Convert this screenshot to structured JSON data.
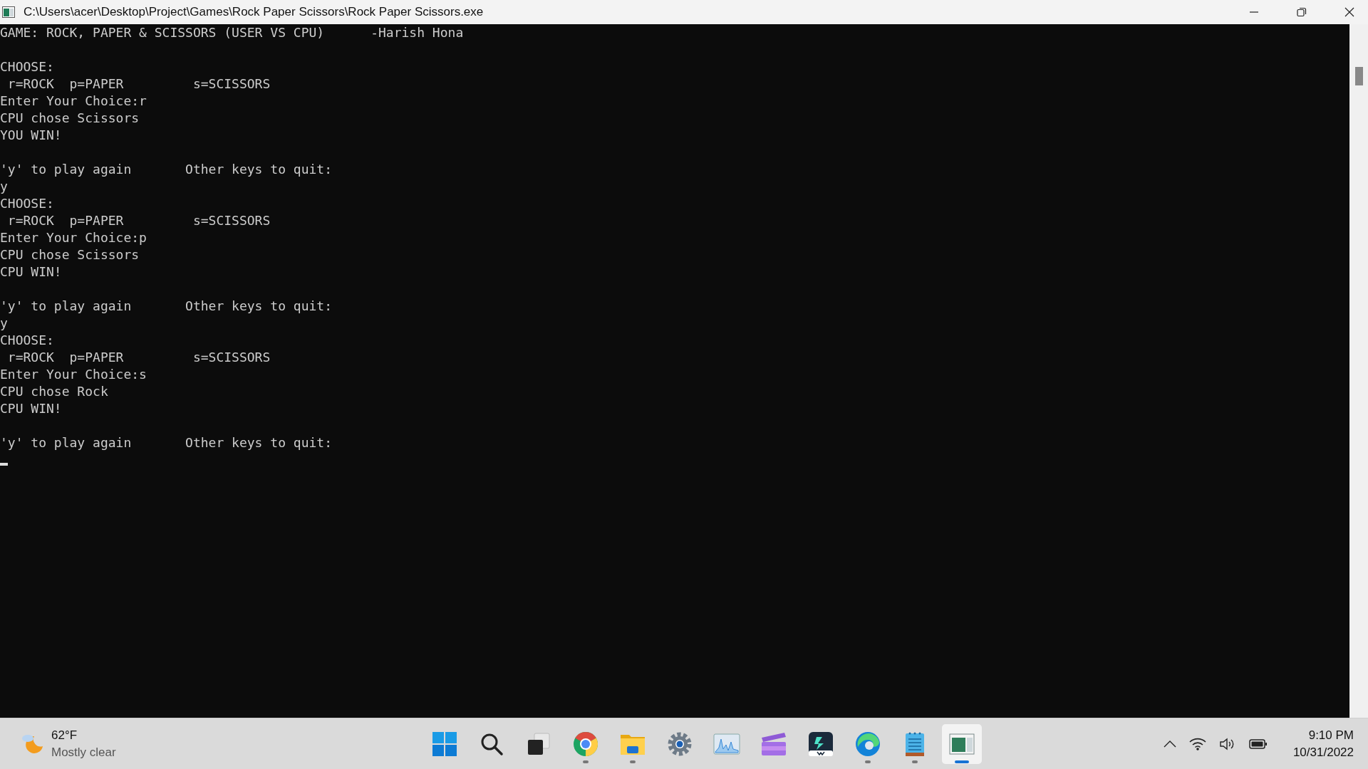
{
  "window": {
    "title": "C:\\Users\\acer\\Desktop\\Project\\Games\\Rock Paper Scissors\\Rock Paper Scissors.exe"
  },
  "console": {
    "blocks": [
      [
        "GAME: ROCK, PAPER & SCISSORS (USER VS CPU)      -Harish Hona"
      ],
      [
        "CHOOSE:",
        " r=ROCK  p=PAPER         s=SCISSORS",
        "Enter Your Choice:r",
        "CPU chose Scissors",
        "YOU WIN!"
      ],
      [
        "'y' to play again       Other keys to quit:",
        "y",
        "CHOOSE:",
        " r=ROCK  p=PAPER         s=SCISSORS",
        "Enter Your Choice:p",
        "CPU chose Scissors",
        "CPU WIN!"
      ],
      [
        "'y' to play again       Other keys to quit:",
        "y",
        "CHOOSE:",
        " r=ROCK  p=PAPER         s=SCISSORS",
        "Enter Your Choice:s",
        "CPU chose Rock",
        "CPU WIN!"
      ],
      [
        "'y' to play again       Other keys to quit:"
      ]
    ],
    "cursor": true
  },
  "taskbar": {
    "weather": {
      "temperature": "62°F",
      "condition": "Mostly clear"
    },
    "apps": [
      {
        "kind": "start",
        "running": false,
        "selected": false
      },
      {
        "kind": "search",
        "running": false,
        "selected": false
      },
      {
        "kind": "taskview",
        "running": false,
        "selected": false
      },
      {
        "kind": "chrome",
        "running": true,
        "selected": false
      },
      {
        "kind": "folder",
        "running": true,
        "selected": false
      },
      {
        "kind": "settings",
        "running": false,
        "selected": false
      },
      {
        "kind": "monitor",
        "running": false,
        "selected": false
      },
      {
        "kind": "clapper",
        "running": false,
        "selected": false
      },
      {
        "kind": "editor",
        "running": false,
        "selected": false
      },
      {
        "kind": "edge",
        "running": true,
        "selected": false
      },
      {
        "kind": "notepad",
        "running": true,
        "selected": false
      },
      {
        "kind": "console",
        "running": true,
        "selected": true
      }
    ],
    "time": "9:10 PM",
    "date": "10/31/2022"
  }
}
